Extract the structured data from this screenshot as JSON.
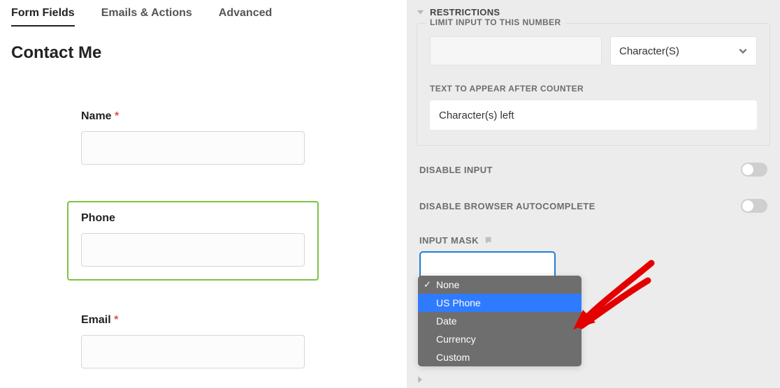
{
  "tabs": {
    "form_fields": "Form Fields",
    "emails_actions": "Emails & Actions",
    "advanced": "Advanced"
  },
  "page_title": "Contact Me",
  "fields": {
    "name": {
      "label": "Name",
      "required": "*"
    },
    "phone": {
      "label": "Phone"
    },
    "email": {
      "label": "Email",
      "required": "*"
    }
  },
  "restrictions": {
    "header": "RESTRICTIONS",
    "limit_label": "LIMIT INPUT TO THIS NUMBER",
    "unit_selected": "Character(S)",
    "counter_label": "TEXT TO APPEAR AFTER COUNTER",
    "counter_value": "Character(s) left",
    "disable_input": "DISABLE INPUT",
    "disable_autocomplete": "DISABLE BROWSER AUTOCOMPLETE",
    "input_mask_label": "INPUT MASK",
    "mask_options": {
      "none": "None",
      "us_phone": "US Phone",
      "date": "Date",
      "currency": "Currency",
      "custom": "Custom"
    }
  }
}
